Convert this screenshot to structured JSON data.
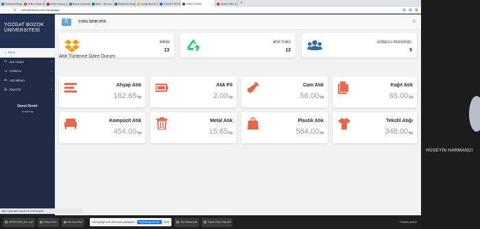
{
  "browser": {
    "tabs": [
      {
        "label": "Elektronik Belge Yö...",
        "color": "#1a73e8"
      },
      {
        "label": "Online Sınav Sis...",
        "color": "#e74c3c"
      },
      {
        "label": "Gelen Kutusu (1.257)",
        "color": "#c5221f"
      },
      {
        "label": "Bozok Üniversitesi",
        "color": "#1e88e5"
      },
      {
        "label": "Meet – bfr-wuy...",
        "color": "#00897b"
      },
      {
        "label": "Elektronik Belge Yö...",
        "color": "#1a73e8"
      },
      {
        "label": "Yozgat Bozok Ünive...",
        "color": "#f4b400"
      },
      {
        "label": "YOZGAT BOZOK ÜN...",
        "color": "#1a73e8"
      },
      {
        "label": "YOBU SIFIRA",
        "color": "#555555",
        "active": true
      },
      {
        "label": "3030417851_Ders...",
        "color": "#e53935"
      }
    ],
    "url": "yobusifir.bozok.edu.tr/Anasayfa"
  },
  "sidebar": {
    "brand_line1": "YOZGAT BOZOK",
    "brand_line2": "ÜNİVERSİTESİ",
    "items": [
      {
        "label": "Birim",
        "icon": "home-icon",
        "active": true,
        "has_arrow": false
      },
      {
        "label": "Atık Türleri",
        "icon": "refresh-icon",
        "active": false,
        "has_arrow": true
      },
      {
        "label": "Kullanıcı",
        "icon": "user-icon",
        "active": false,
        "has_arrow": true
      },
      {
        "label": "Atık Miktarı",
        "icon": "scale-icon",
        "active": false,
        "has_arrow": true
      },
      {
        "label": "Raporlar",
        "icon": "report-icon",
        "active": false,
        "has_arrow": true
      }
    ],
    "user_name": "Davut Demir",
    "user_role": "Yetkilirolle"
  },
  "header": {
    "menu_icon": "menu-icon",
    "title": "YOBU SIFIR ATIK",
    "logout_icon": "logout-icon"
  },
  "stats": [
    {
      "label": "BİRİM",
      "value": "13",
      "icon": "dropbox-icon",
      "color": "#f39c12"
    },
    {
      "label": "ATIK TÜRÜ",
      "value": "12",
      "icon": "recycle-icon",
      "color": "#2ecc71"
    },
    {
      "label": "GÖREVLİ PERSONEL",
      "value": "5",
      "icon": "users-icon",
      "color": "#2e6da4"
    }
  ],
  "section_title": "Atık Türlerine Göre Durum",
  "waste": [
    {
      "name": "Ahşap Atık",
      "value": "162.65",
      "unit": "kg",
      "icon": "wood-icon"
    },
    {
      "name": "Atık Pil",
      "value": "2.00",
      "unit": "kg",
      "icon": "battery-icon"
    },
    {
      "name": "Cam Atık",
      "value": "56.00",
      "unit": "kg",
      "icon": "bottle-icon"
    },
    {
      "name": "Kağıt Atık",
      "value": "65.00",
      "unit": "kg",
      "icon": "paper-icon"
    },
    {
      "name": "Kompozit Atık",
      "value": "454.00",
      "unit": "kg",
      "icon": "sofa-icon"
    },
    {
      "name": "Metal Atık",
      "value": "15.65",
      "unit": "kg",
      "icon": "trash-icon"
    },
    {
      "name": "Plastik Atık",
      "value": "564.00",
      "unit": "kg",
      "icon": "bag-icon"
    },
    {
      "name": "Tekstil Atığı",
      "value": "348.00",
      "unit": "kg",
      "icon": "shirt-icon"
    }
  ],
  "accent": "#e8664a",
  "status_url": "https://yobusifir.bozok.edu.tr/Anasayfa",
  "taskbar": {
    "items": [
      "3030417851_Da...pdf",
      "Online Ders",
      "Mü Ders Ekle"
    ],
    "notice_text": "meet.google.com ekranınızı paylaşıyor.",
    "notice_button": "Paylaşmayı durdur",
    "notice_hide": "Gizle",
    "right_items": [
      "Yeni Sürüm.pdf",
      "Eylem Planı Ekle.pdf"
    ],
    "show_all": "Tümünü göster"
  },
  "video": {
    "participant": "HÜSEYİN HARMANCI"
  }
}
